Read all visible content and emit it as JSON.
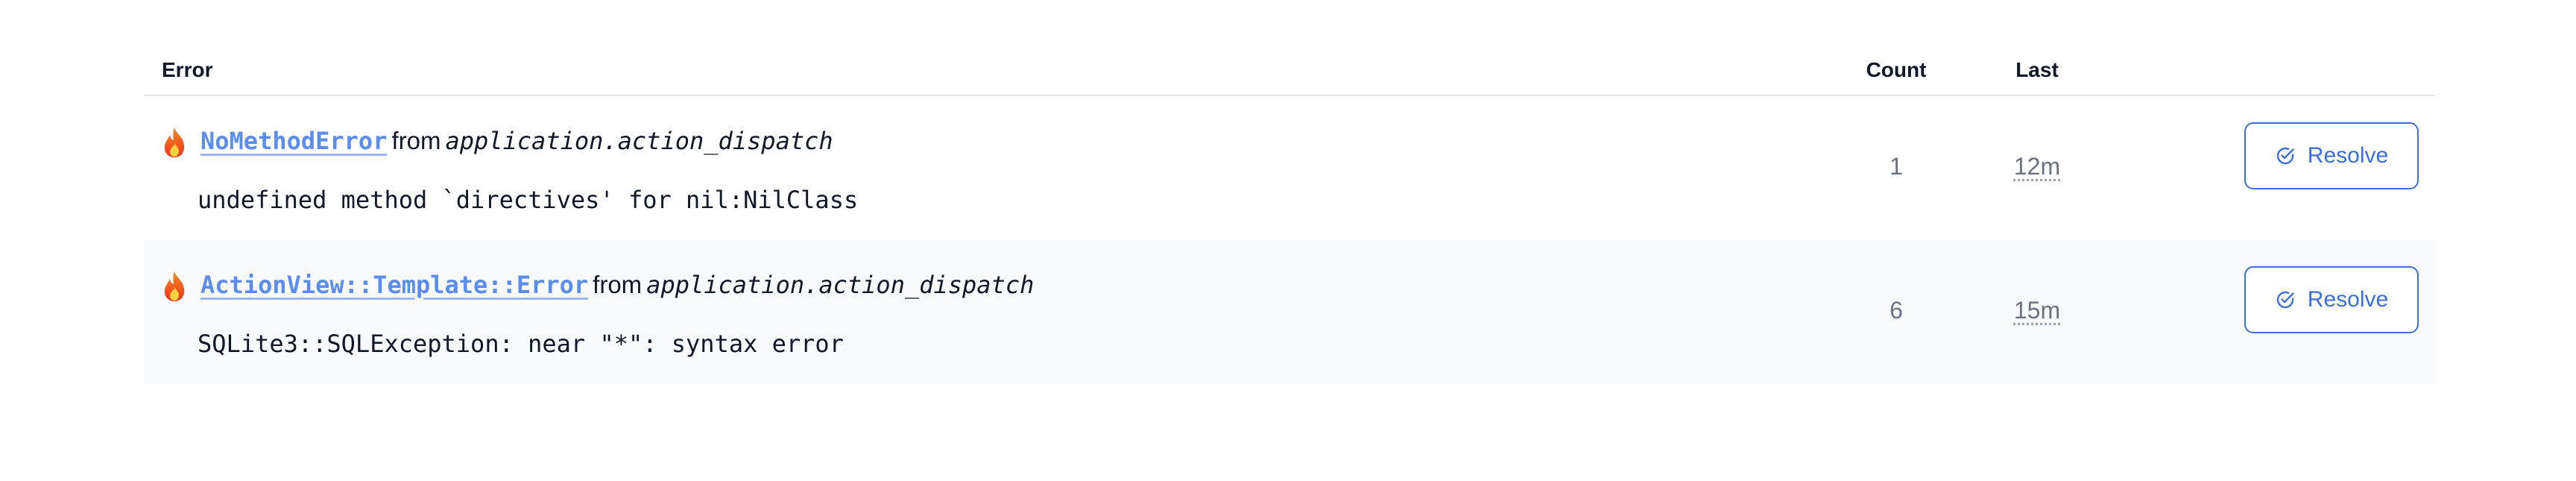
{
  "table": {
    "headers": {
      "error": "Error",
      "count": "Count",
      "last": "Last"
    },
    "rows": [
      {
        "icon": "fire-icon",
        "error_class": "NoMethodError",
        "from": "from",
        "source": "application.action_dispatch",
        "message": "undefined method `directives' for nil:NilClass",
        "count": "1",
        "last": "12m",
        "resolve_label": "Resolve"
      },
      {
        "icon": "fire-icon",
        "error_class": "ActionView::Template::Error",
        "from": "from",
        "source": "application.action_dispatch",
        "message": "SQLite3::SQLException: near \"*\": syntax error",
        "count": "6",
        "last": "15m",
        "resolve_label": "Resolve"
      }
    ]
  },
  "colors": {
    "link": "#5b8def",
    "button": "#3b6fd9",
    "alt_row": "#f8fafc",
    "muted": "#6b7280"
  }
}
